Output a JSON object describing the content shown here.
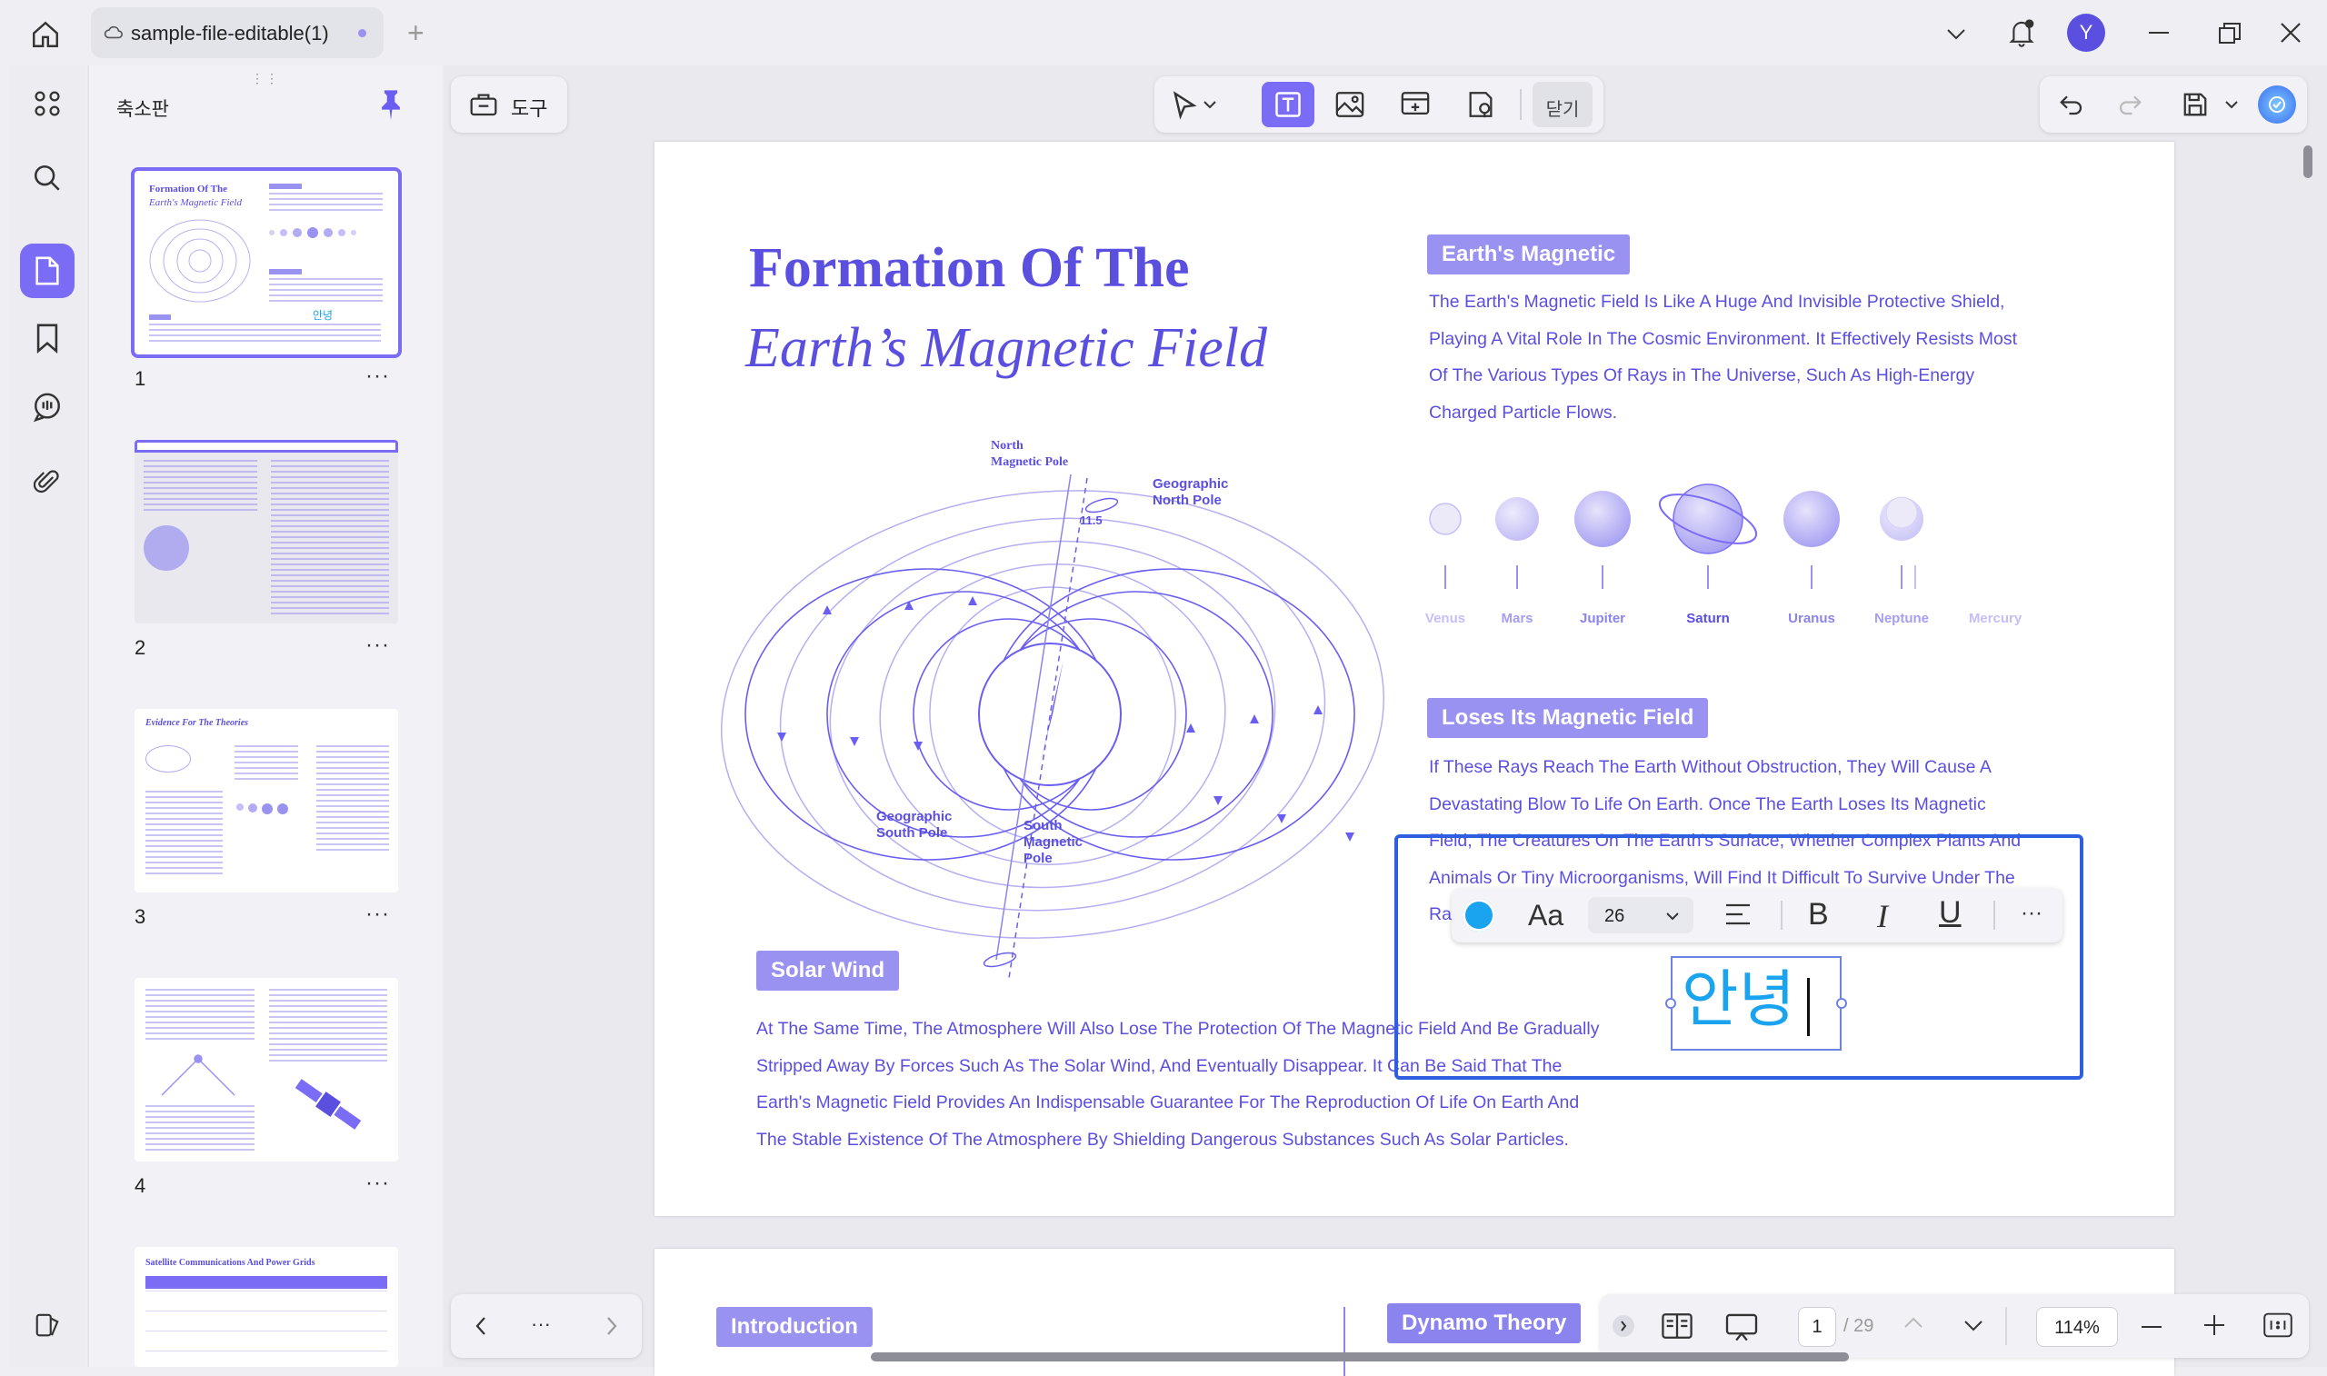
{
  "window": {
    "tab_title": "sample-file-editable(1)",
    "avatar_letter": "Y",
    "accent": "#7b6cf6"
  },
  "sidebar_rail": {
    "icons": [
      "grid-icon",
      "search-icon",
      "pages-icon",
      "bookmark-icon",
      "comment-icon",
      "attachment-icon",
      "theme-icon"
    ]
  },
  "thumbnails": {
    "panel_title": "축소판",
    "pages": [
      {
        "number": "1",
        "title": "Formation Of The",
        "subtitle": "Earth's Magnetic Field",
        "note": "안녕"
      },
      {
        "number": "2"
      },
      {
        "number": "3",
        "title": "Evidence For The Theories"
      },
      {
        "number": "4"
      },
      {
        "number": "",
        "title": "Satellite Communications And Power Grids"
      }
    ],
    "more_label": "···"
  },
  "toolbar": {
    "tools_label": "도구",
    "close_label": "닫기"
  },
  "document": {
    "title_line1": "Formation Of The",
    "title_line2": "Earth’s Magnetic Field",
    "diagram": {
      "north_magnetic": [
        "North",
        "Magnetic Pole"
      ],
      "geo_north": [
        "Geographic",
        "North Pole"
      ],
      "angle": "11.5",
      "geo_south": [
        "Geographic",
        "South Pole"
      ],
      "south_magnetic": [
        "South",
        "Magnetic",
        "Pole"
      ]
    },
    "earths_magnetic": {
      "heading": "Earth's Magnetic",
      "lines": [
        "The Earth's Magnetic Field Is Like A Huge And Invisible Protective Shield,",
        "Playing A Vital Role In The Cosmic Environment. It Effectively Resists Most",
        "Of The Various Types Of Rays in The Universe, Such As High-Energy",
        "Charged Particle Flows."
      ]
    },
    "planets": [
      "Venus",
      "Mars",
      "Jupiter",
      "Saturn",
      "Uranus",
      "Neptune",
      "Mercury"
    ],
    "loses": {
      "heading": "Loses Its Magnetic Field",
      "lines": [
        "If These Rays Reach The Earth Without Obstruction, They Will Cause A",
        "Devastating Blow To Life On Earth. Once The Earth Loses Its Magnetic",
        "Field, The Creatures On The Earth's Surface, Whether Complex Plants And",
        "Animals Or Tiny Microorganisms, Will Find It Difficult To Survive Under The",
        "Ra"
      ]
    },
    "solar_wind": {
      "heading": "Solar Wind",
      "lines": [
        "At The Same Time, The Atmosphere Will Also Lose The Protection Of The Magnetic Field And Be Gradually",
        "Stripped Away By Forces Such As The Solar Wind, And Eventually Disappear. It Can Be Said That The",
        "Earth's Magnetic Field Provides An Indispensable Guarantee For The Reproduction Of Life On Earth And",
        "The Stable Existence Of The Atmosphere By Shielding Dangerous Substances Such As Solar Particles."
      ]
    },
    "edit_text": "안녕",
    "page2": {
      "introduction": "Introduction",
      "dynamo": "Dynamo Theory"
    }
  },
  "text_toolbar": {
    "color": "#1aa3ee",
    "font_label": "Aa",
    "font_size": "26",
    "bold_label": "B",
    "italic_label": "I",
    "underline_label": "U",
    "more_label": "···"
  },
  "bottom_nav": {
    "more_label": "···",
    "current_page": "1",
    "total_pages": "/ 29",
    "zoom": "114%"
  }
}
